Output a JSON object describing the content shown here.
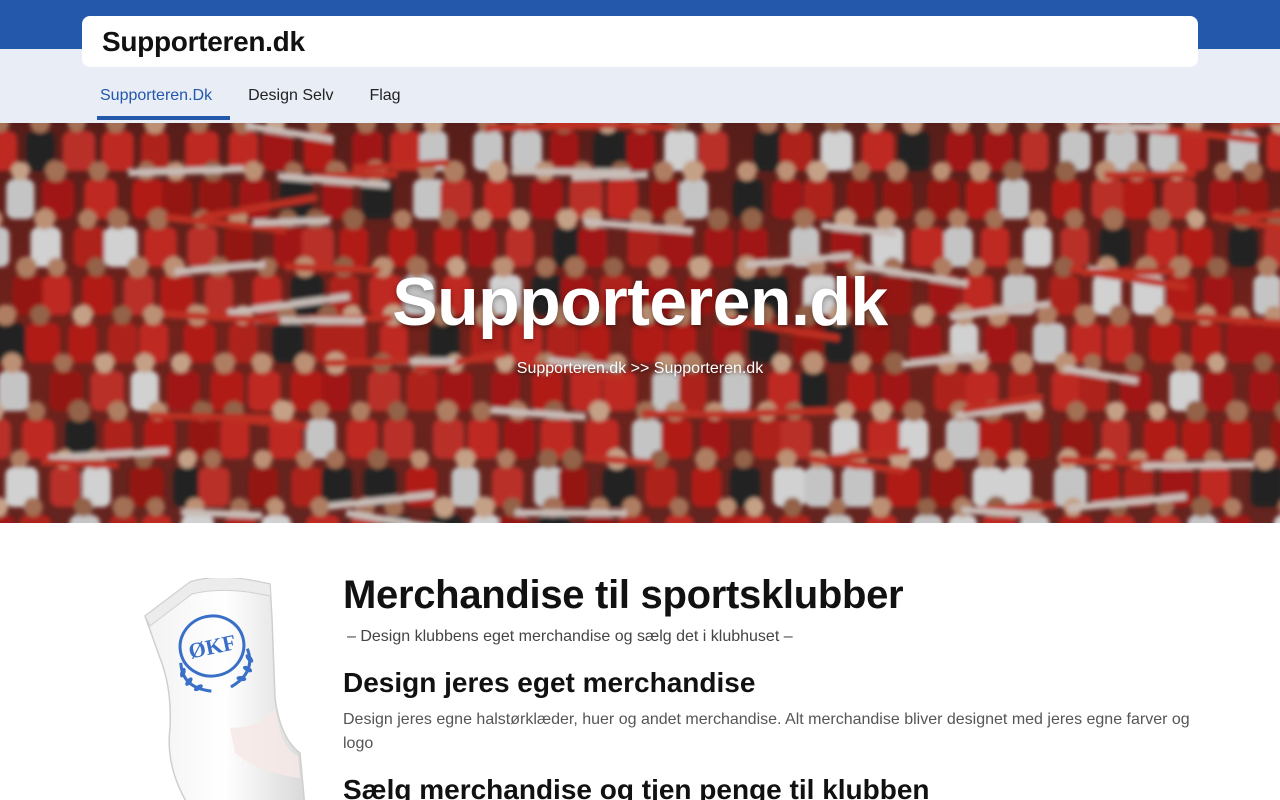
{
  "header": {
    "logo_text": "Supporteren.dk",
    "brand_color": "#2458ab"
  },
  "nav": {
    "items": [
      {
        "label": "Supporteren.Dk",
        "active": true
      },
      {
        "label": "Design Selv",
        "active": false
      },
      {
        "label": "Flag",
        "active": false
      }
    ]
  },
  "hero": {
    "title": "Supporteren.dk",
    "breadcrumb": {
      "first": "Supporteren.dk",
      "separator": ">>",
      "second": "Supporteren.dk"
    }
  },
  "main": {
    "heading": "Merchandise til sportsklubber",
    "tagline": "– Design klubbens eget merchandise og sælg det i klubhuset –",
    "section1_heading": "Design jeres eget merchandise",
    "section1_text": "Design jeres egne halstørklæder, huer og andet merchandise. Alt merchandise bliver designet med jeres egne farver og logo",
    "section2_heading": "Sælg merchandise og tjen penge til klubben",
    "product_logo_text": "ØKF"
  }
}
